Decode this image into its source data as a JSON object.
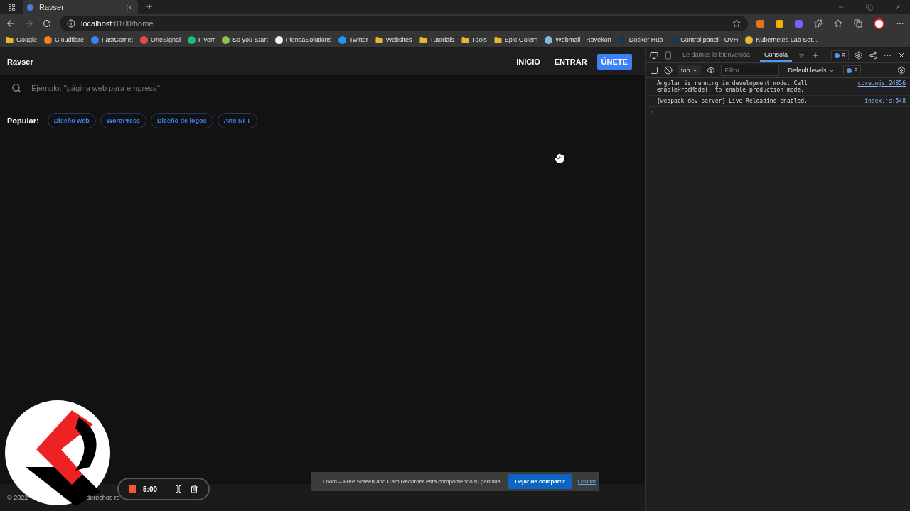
{
  "browser": {
    "tab": {
      "title": "Ravser"
    },
    "address": {
      "host": "localhost",
      "path": ":8100/home"
    },
    "bookmarks": [
      {
        "label": "Google",
        "kind": "folder",
        "color": "#e8b730"
      },
      {
        "label": "Cloudflare",
        "kind": "site",
        "color": "#f38020"
      },
      {
        "label": "FastComet",
        "kind": "site",
        "color": "#3b82f6"
      },
      {
        "label": "OneSignal",
        "kind": "site",
        "color": "#e54b4d"
      },
      {
        "label": "Fiverr",
        "kind": "site",
        "color": "#1dbf73"
      },
      {
        "label": "So you Start",
        "kind": "site",
        "color": "#8bc34a"
      },
      {
        "label": "PiensaSolutions",
        "kind": "site",
        "color": "#f2f2f2"
      },
      {
        "label": "Twitter",
        "kind": "site",
        "color": "#1d9bf0"
      },
      {
        "label": "Websites",
        "kind": "folder",
        "color": "#e8b730"
      },
      {
        "label": "Tutorials",
        "kind": "folder",
        "color": "#e8b730"
      },
      {
        "label": "Tools",
        "kind": "folder",
        "color": "#e8b730"
      },
      {
        "label": "Epic Golem",
        "kind": "folder",
        "color": "#e8b730"
      },
      {
        "label": "Webmail - Ravekon",
        "kind": "site",
        "color": "#7fb8d8"
      },
      {
        "label": "Docker Hub",
        "kind": "site",
        "color": "#1e3550"
      },
      {
        "label": "Control panel - OVH",
        "kind": "site",
        "color": "#1e3550"
      },
      {
        "label": "Kubernetes Lab Set...",
        "kind": "site",
        "color": "#e8b730"
      }
    ]
  },
  "page": {
    "brand": "Ravser",
    "nav": [
      {
        "label": "INICIO",
        "kind": "text"
      },
      {
        "label": "ENTRAR",
        "kind": "text"
      },
      {
        "label": "ÚNETE",
        "kind": "primary"
      }
    ],
    "search": {
      "placeholder": "Ejemplo: \"página web para empresa\""
    },
    "popular": {
      "label": "Popular:",
      "tags": [
        "Diseño web",
        "WordPress",
        "Diseño de logos",
        "Arte NFT"
      ]
    },
    "footer": [
      "© 2022",
      "derechos re"
    ]
  },
  "devtools": {
    "tabs": [
      {
        "label": "Le damos la bienvenida",
        "selected": false
      },
      {
        "label": "Consola",
        "selected": true
      }
    ],
    "issues_count": "9",
    "context": "top",
    "filter": {
      "placeholder": "Filtro"
    },
    "levels": "Default levels",
    "message_count": "9",
    "messages": [
      {
        "text": "Angular is running in development mode. Call enableProdMode() to enable production mode.",
        "source": "core.mjs:24856"
      },
      {
        "text": "[webpack-dev-server] Live Reloading enabled.",
        "source": "index.js:548"
      }
    ],
    "prompt": "›"
  },
  "recorder": {
    "time": "5:00"
  },
  "sharing_bar": {
    "message": "Loom – Free Screen and Cam Recorder está compartiendo tu pantalla.",
    "stop": "Dejar de compartir",
    "hide": "Ocultar"
  }
}
